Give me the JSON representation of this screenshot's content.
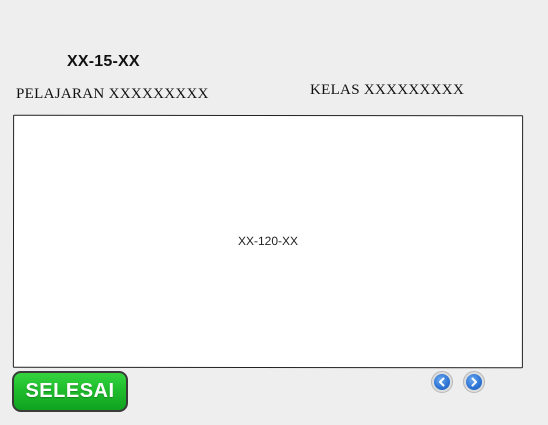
{
  "header": {
    "code": "XX-15-XX",
    "subject_label": "PELAJARAN XXXXXXXXX",
    "class_label": "KELAS XXXXXXXXX"
  },
  "content": {
    "code": "XX-120-XX"
  },
  "footer": {
    "finish_label": "SELESAI",
    "prev_icon": "chevron-left-icon",
    "next_icon": "chevron-right-icon"
  },
  "colors": {
    "background": "#eeeeee",
    "finish_button": "#1fbd2d",
    "nav_button": "#2f76d6"
  }
}
